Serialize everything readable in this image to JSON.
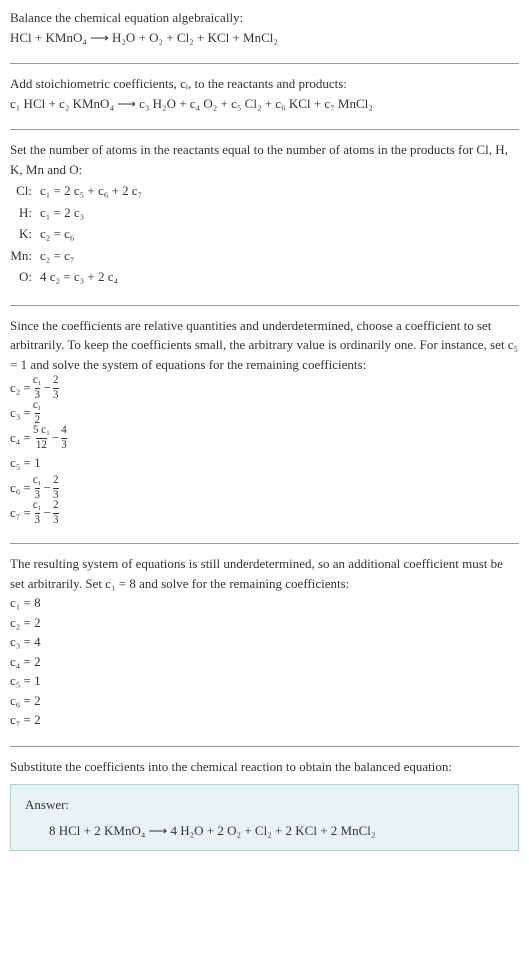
{
  "intro": {
    "line1": "Balance the chemical equation algebraically:",
    "eq": "HCl + KMnO₄  ⟶  H₂O + O₂ + Cl₂ + KCl + MnCl₂"
  },
  "step1": {
    "text": "Add stoichiometric coefficients, cᵢ, to the reactants and products:",
    "eq": "c₁ HCl + c₂ KMnO₄  ⟶  c₃ H₂O + c₄ O₂ + c₅ Cl₂ + c₆ KCl + c₇ MnCl₂"
  },
  "step2": {
    "text": "Set the number of atoms in the reactants equal to the number of atoms in the products for Cl, H, K, Mn and O:",
    "rows": [
      {
        "label": "Cl:",
        "eq": "c₁ = 2 c₅ + c₆ + 2 c₇"
      },
      {
        "label": "H:",
        "eq": "c₁ = 2 c₃"
      },
      {
        "label": "K:",
        "eq": "c₂ = c₆"
      },
      {
        "label": "Mn:",
        "eq": "c₂ = c₇"
      },
      {
        "label": "O:",
        "eq": "4 c₂ = c₃ + 2 c₄"
      }
    ]
  },
  "step3": {
    "text": "Since the coefficients are relative quantities and underdetermined, choose a coefficient to set arbitrarily. To keep the coefficients small, the arbitrary value is ordinarily one. For instance, set c₅ = 1 and solve the system of equations for the remaining coefficients:",
    "c2": {
      "lhs": "c₂ = ",
      "n1": "c₁",
      "d1": "3",
      "mid": " − ",
      "n2": "2",
      "d2": "3"
    },
    "c3": {
      "lhs": "c₃ = ",
      "n1": "c₁",
      "d1": "2"
    },
    "c4": {
      "lhs": "c₄ = ",
      "n1": "5 c₁",
      "d1": "12",
      "mid": " − ",
      "n2": "4",
      "d2": "3"
    },
    "c5": "c₅ = 1",
    "c6": {
      "lhs": "c₆ = ",
      "n1": "c₁",
      "d1": "3",
      "mid": " − ",
      "n2": "2",
      "d2": "3"
    },
    "c7": {
      "lhs": "c₇ = ",
      "n1": "c₁",
      "d1": "3",
      "mid": " − ",
      "n2": "2",
      "d2": "3"
    }
  },
  "step4": {
    "text": "The resulting system of equations is still underdetermined, so an additional coefficient must be set arbitrarily. Set c₁ = 8 and solve for the remaining coefficients:",
    "rows": [
      "c₁ = 8",
      "c₂ = 2",
      "c₃ = 4",
      "c₄ = 2",
      "c₅ = 1",
      "c₆ = 2",
      "c₇ = 2"
    ]
  },
  "final": {
    "text": "Substitute the coefficients into the chemical reaction to obtain the balanced equation:",
    "answer_label": "Answer:",
    "answer_eq": "8 HCl + 2 KMnO₄  ⟶  4 H₂O + 2 O₂ + Cl₂ + 2 KCl + 2 MnCl₂"
  },
  "chart_data": {
    "type": "table",
    "title": "Balanced stoichiometric coefficients",
    "categories": [
      "c₁",
      "c₂",
      "c₃",
      "c₄",
      "c₅",
      "c₆",
      "c₇"
    ],
    "values": [
      8,
      2,
      4,
      2,
      1,
      2,
      2
    ]
  }
}
